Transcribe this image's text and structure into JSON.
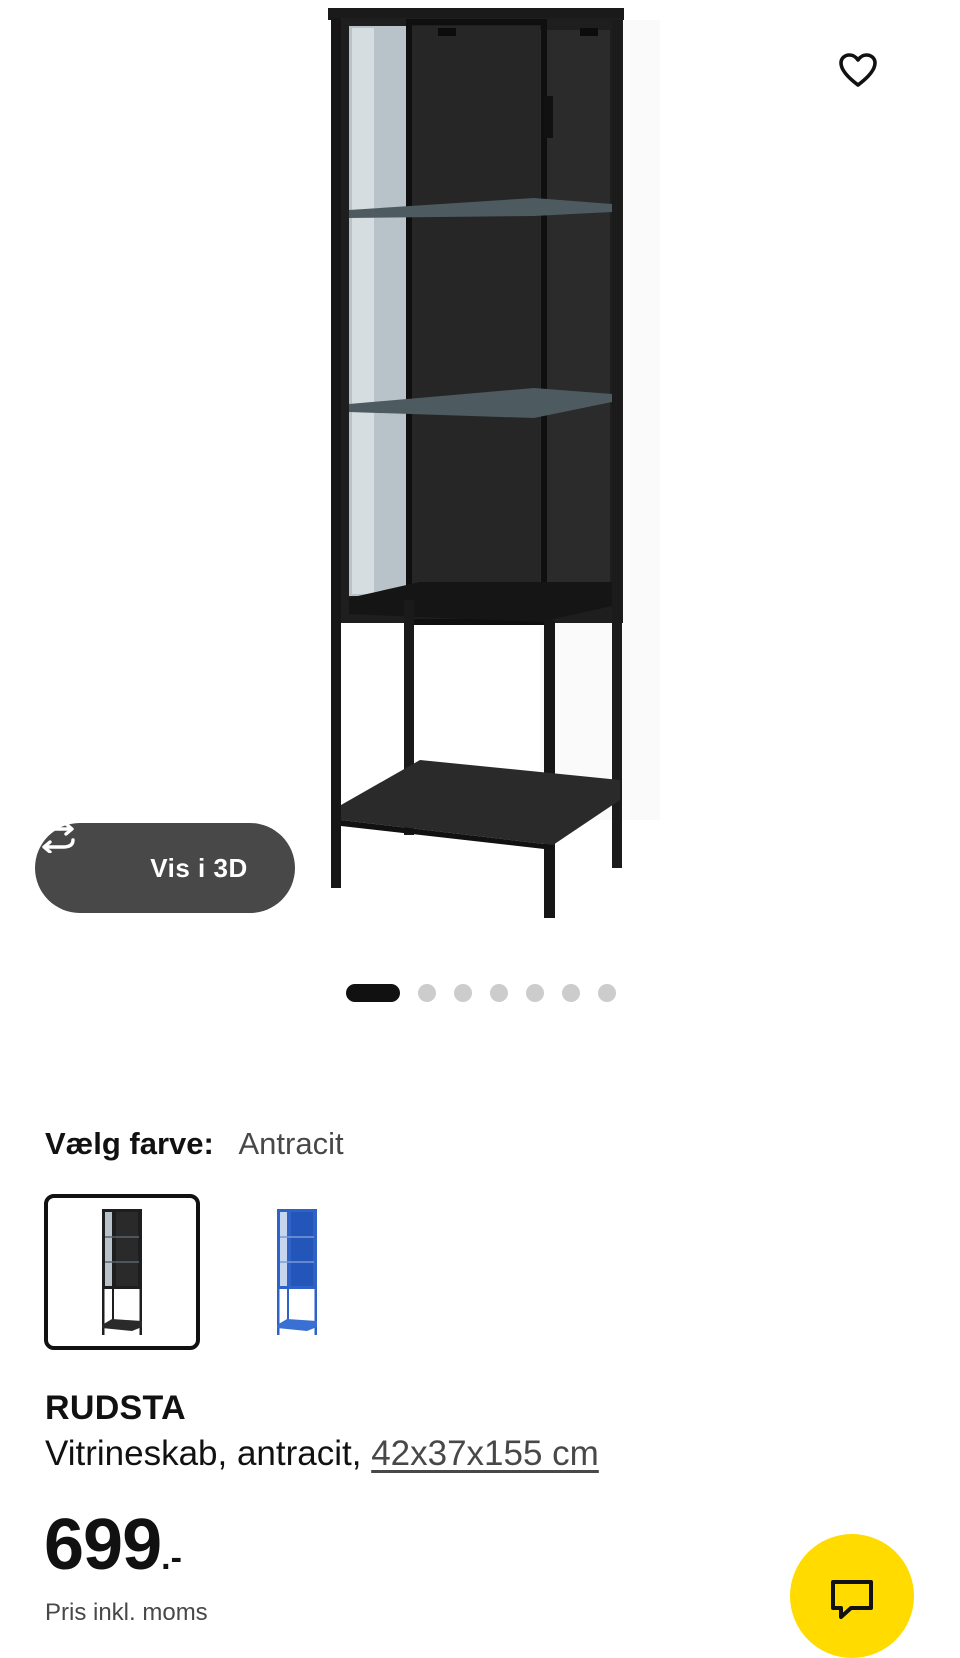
{
  "actions": {
    "view_3d_label": "Vis i 3D",
    "favourite_icon": "heart-outline-icon",
    "rotate_icon": "rotate-arrows-icon",
    "chat_icon": "speech-bubble-icon"
  },
  "carousel": {
    "total_images": 7,
    "active_index": 0
  },
  "color_selector": {
    "label": "Vælg farve:",
    "selected_value": "Antracit",
    "options": [
      {
        "name": "Antracit",
        "selected": true,
        "color": "#1e1e1e"
      },
      {
        "name": "Blå",
        "selected": false,
        "color": "#2f62c7"
      }
    ]
  },
  "product": {
    "name": "RUDSTA",
    "description": "Vitrineskab, antracit, ",
    "dimensions": "42x37x155 cm",
    "price": "699",
    "price_suffix": ".-",
    "price_note": "Pris inkl. moms"
  },
  "colors": {
    "accent_yellow": "#ffdb00",
    "button_dark": "#484848",
    "text_primary": "#111111",
    "text_secondary": "#484848",
    "dot_inactive": "#cccccc",
    "cabinet": "#1e1e1e"
  }
}
